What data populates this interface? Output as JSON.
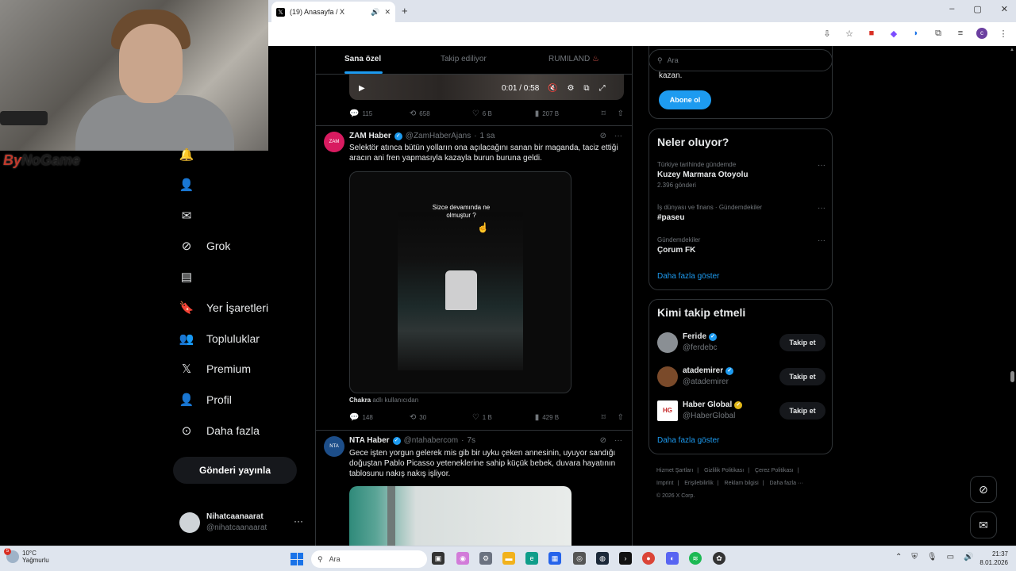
{
  "browser": {
    "tab_title": "(19) Anasayfa / X",
    "new_tab": "+",
    "window_controls": [
      "–",
      "▢",
      "✕"
    ]
  },
  "webcam": {
    "brand_prefix": "By",
    "brand_main": "NoGame"
  },
  "nav": {
    "items": [
      {
        "label": "Grok",
        "icon": "grok-icon"
      },
      {
        "label": "",
        "icon": "lists-icon"
      },
      {
        "label": "Yer İşaretleri",
        "icon": "bookmark-icon"
      },
      {
        "label": "Topluluklar",
        "icon": "communities-icon"
      },
      {
        "label": "Premium",
        "icon": "x-logo-icon"
      },
      {
        "label": "Profil",
        "icon": "profile-icon"
      },
      {
        "label": "Daha fazla",
        "icon": "more-circle-icon"
      }
    ],
    "post_button": "Gönderi yayınla",
    "account": {
      "display_name": "Nihatcaanaarat",
      "handle": "@nihatcaanaarat",
      "more": "···"
    }
  },
  "timeline": {
    "tabs": [
      "Sana özel",
      "Takip ediliyor",
      "RUMILAND"
    ],
    "tab_hot": "♨",
    "top_video": {
      "time": "0:01 / 0:58"
    },
    "top_actions": {
      "replies": "115",
      "reposts": "658",
      "likes": "6 B",
      "views": "207 B"
    },
    "tweets": [
      {
        "name": "ZAM Haber",
        "handle": "@ZamHaberAjans",
        "time": "1 sa",
        "avatar_text": "ZAM",
        "text": "Selektör atınca bütün yolların ona açılacağını sanan bir maganda, taciz ettiği aracın ani fren yapmasıyla kazayla burun buruna geldi.",
        "video_overlay": "Sizce devamında ne olmuştur ?",
        "caption_user": "Chakra",
        "caption_rest": " adlı kullanıcıdan",
        "actions": {
          "replies": "148",
          "reposts": "30",
          "likes": "1 B",
          "views": "429 B"
        }
      },
      {
        "name": "NTA Haber",
        "handle": "@ntahabercom",
        "time": "7s",
        "avatar_text": "NTA",
        "text": "Gece işten yorgun gelerek mis gib bir uyku çeken annesinin, uyuyor sandığı doğuştan Pablo Picasso yeteneklerine sahip küçük bebek, duvara hayatının tablosunu nakış nakış işliyor."
      }
    ]
  },
  "sidebar": {
    "search_placeholder": "Ara",
    "premium_text": "kazan.",
    "subscribe": "Abone ol",
    "trends_title": "Neler oluyor?",
    "trends": [
      {
        "context": "Türkiye tarihinde gündemde",
        "title": "Kuzey Marmara Otoyolu",
        "count": "2.396 gönderi"
      },
      {
        "context": "İş dünyası ve finans · Gündemdekiler",
        "title": "#paseu",
        "count": ""
      },
      {
        "context": "Gündemdekiler",
        "title": "Çorum FK",
        "count": ""
      }
    ],
    "show_more": "Daha fazla göster",
    "who_title": "Kimi takip etmeli",
    "who": [
      {
        "name": "Feride",
        "handle": "@ferdebc",
        "button": "Takip et",
        "badge": "blue"
      },
      {
        "name": "atademirer",
        "handle": "@atademirer",
        "button": "Takip et",
        "badge": "blue"
      },
      {
        "name": "Haber Global",
        "handle": "@HaberGlobal",
        "button": "Takip et",
        "badge": "gold",
        "avatar_text": "HG"
      }
    ],
    "footer": [
      "Hizmet Şartları",
      "|",
      "Gizlilik Politikası",
      "|",
      "Çerez Politikası",
      "|",
      "Imprint",
      "|",
      "Erişilebilirlik",
      "|",
      "Reklam bilgisi",
      "|",
      "Daha fazla ···",
      "© 2026 X Corp."
    ]
  },
  "taskbar": {
    "temperature": "10°C",
    "weather": "Yağmurlu",
    "weather_badge": "5",
    "search": "Ara",
    "time": "21:37",
    "date": "8.01.2026"
  },
  "colors": {
    "accent": "#1d9bf0",
    "bg": "#000000",
    "border": "#2f3336",
    "muted": "#71767b"
  }
}
